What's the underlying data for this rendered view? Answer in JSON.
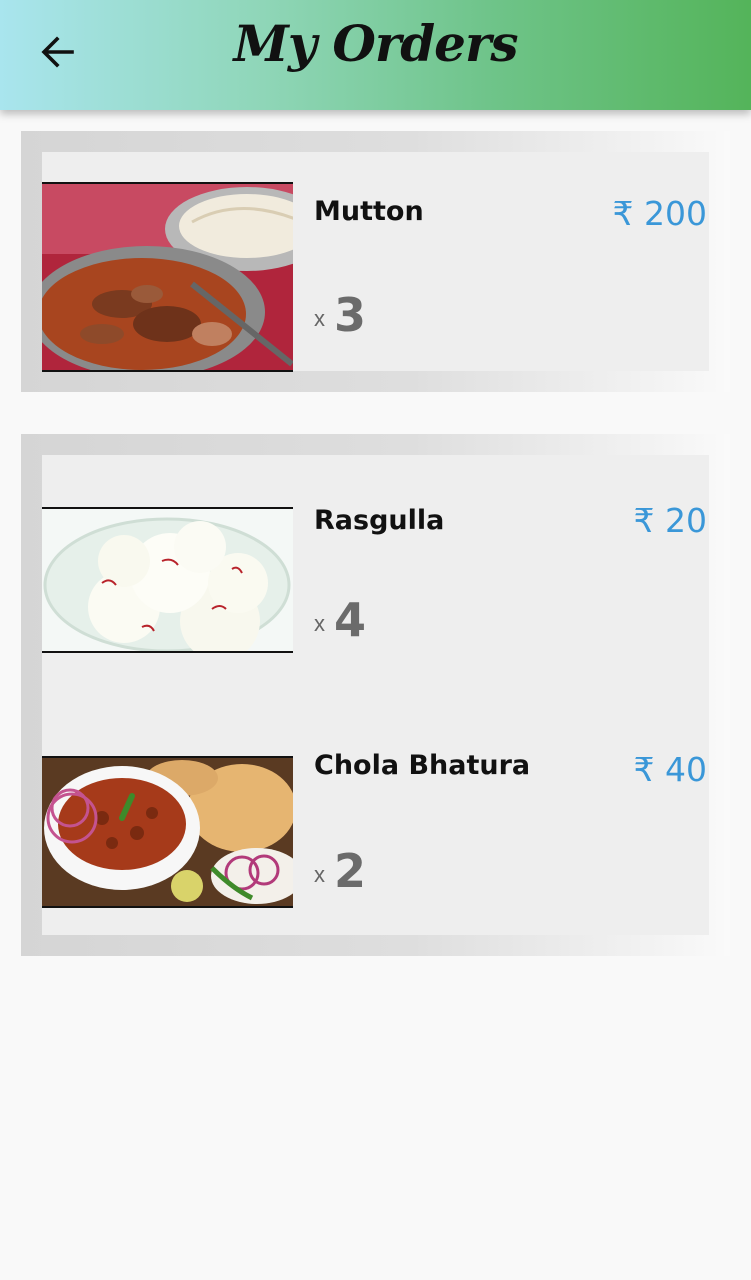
{
  "header": {
    "title": "My Orders",
    "back_icon": "arrow-left-icon",
    "gradient_colors": [
      "#a9e5ee",
      "#54b45a"
    ]
  },
  "orders": [
    {
      "items": [
        {
          "name": "Mutton",
          "price": "₹ 200",
          "qty_prefix": "x",
          "qty": "3",
          "image": "mutton-curry-image"
        }
      ]
    },
    {
      "items": [
        {
          "name": "Rasgulla",
          "price": "₹ 20",
          "qty_prefix": "x",
          "qty": "4",
          "image": "rasgulla-image"
        },
        {
          "name": "Chola Bhatura",
          "price": "₹ 40",
          "qty_prefix": "x",
          "qty": "2",
          "image": "chola-bhatura-image"
        }
      ]
    }
  ],
  "colors": {
    "price": "#3a97d8",
    "card_bg": "#eeeeee",
    "page_bg": "#f9f9f9"
  }
}
